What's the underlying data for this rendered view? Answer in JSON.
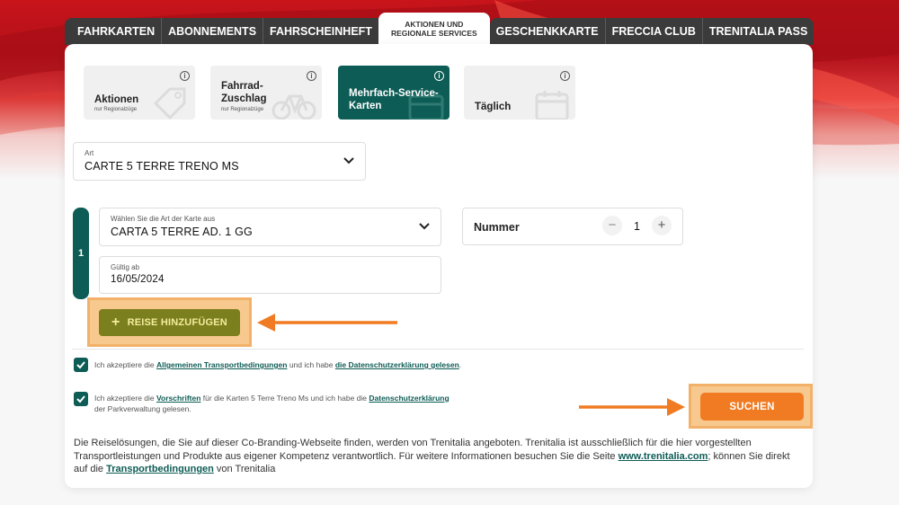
{
  "tabs": [
    {
      "label": "FAHRKARTEN"
    },
    {
      "label": "ABONNEMENTS"
    },
    {
      "label": "FAHRSCHEINHEFT"
    },
    {
      "label_line1": "AKTIONEN UND",
      "label_line2": "REGIONALE SERVICES",
      "active": true
    },
    {
      "label": "GESCHENKKARTE"
    },
    {
      "label": "FRECCIA CLUB"
    },
    {
      "label": "TRENITALIA PASS"
    }
  ],
  "type_tiles": [
    {
      "title": "Aktionen",
      "subtitle": "nur Regionalzüge",
      "icon": "tag-icon"
    },
    {
      "title_line1": "Fahrrad-",
      "title_line2": "Zuschlag",
      "subtitle": "nur Regionalzüge",
      "icon": "bicycle-icon"
    },
    {
      "title_line1": "Mehrfach-Service-",
      "title_line2": "Karten",
      "icon": "card-icon",
      "active": true
    },
    {
      "title": "Täglich",
      "icon": "calendar-icon"
    }
  ],
  "info_glyph": "i",
  "art_select": {
    "label": "Art",
    "value": "CARTE 5 TERRE TRENO MS"
  },
  "trip": {
    "number": "1",
    "card_type": {
      "label": "Wählen Sie die Art der Karte aus",
      "value": "CARTA 5 TERRE AD. 1 GG"
    },
    "valid_from": {
      "label": "Gültig ab",
      "value": "16/05/2024"
    },
    "quantity": {
      "label": "Nummer",
      "value": "1",
      "minus": "−",
      "plus": "+"
    }
  },
  "add_trip_button": {
    "label": "REISE HINZUFÜGEN",
    "plus": "+"
  },
  "consent1": {
    "t1": "Ich akzeptiere die ",
    "link1": "Allgemeinen Transportbedingungen",
    "t2": " und ich habe ",
    "link2": "die Datenschutzerklärung gelesen",
    "t3": "."
  },
  "consent2": {
    "t1": "Ich akzeptiere die ",
    "link1": "Vorschriften",
    "t2": " für die Karten 5 Terre Treno Ms und ich habe die ",
    "link2": "Datenschutzerklärung",
    "t3": "der Parkverwaltung gelesen."
  },
  "search_button": {
    "label": "SUCHEN"
  },
  "disclaimer": {
    "t1": "Die Reiselösungen, die Sie auf dieser Co-Branding-Webseite finden, werden von Trenitalia angeboten. Trenitalia ist ausschließlich für die hier vorgestellten Transportleistungen und Produkte aus eigener Kompetenz verantwortlich. Für weitere Informationen besuchen Sie die Seite ",
    "link1": "www.trenitalia.com",
    "t2": "; können Sie direkt auf die ",
    "link2": "Transportbedingungen",
    "t3": " von Trenitalia"
  },
  "colors": {
    "accent_green": "#0d5c55",
    "add_button": "#7c7f1d",
    "search_button": "#f07b22",
    "highlight": "#f8c98f",
    "arrow": "#f07b22",
    "tab_bar": "#3b3b3b"
  }
}
